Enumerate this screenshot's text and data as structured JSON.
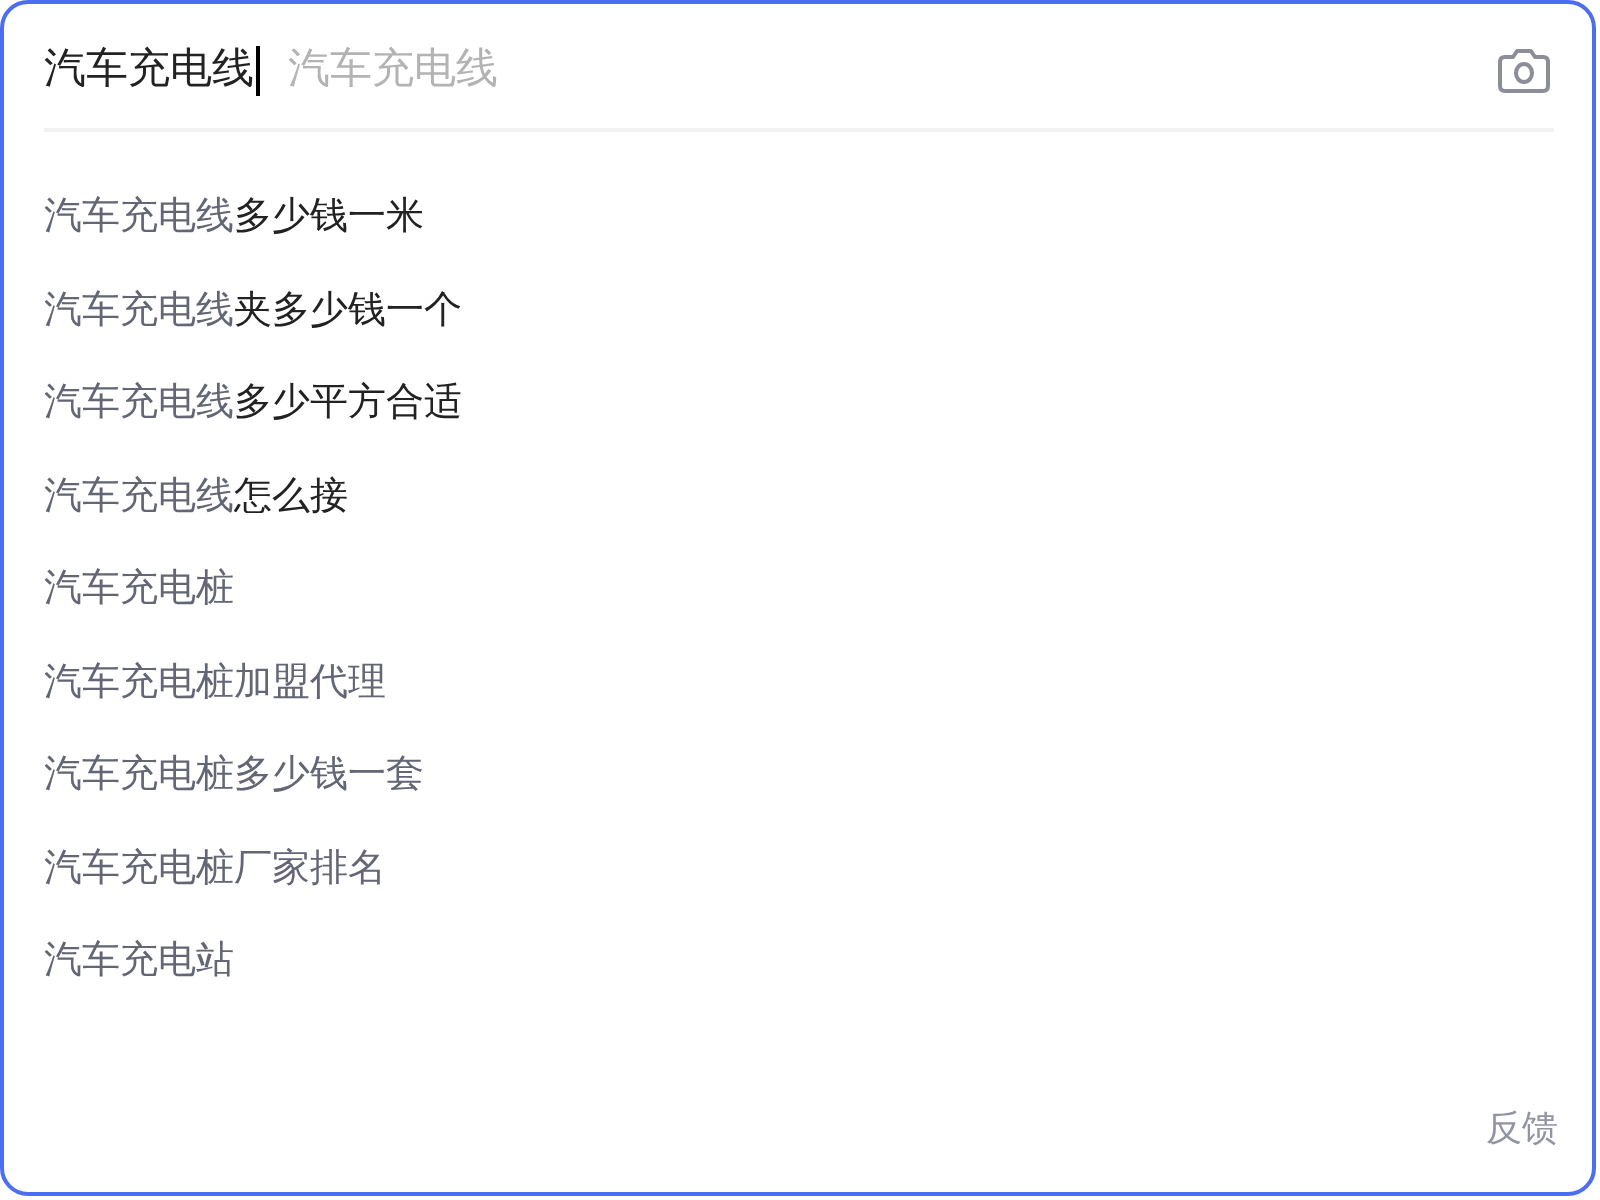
{
  "search": {
    "value": "汽车充电线",
    "focused": true,
    "completion": "汽车充电线"
  },
  "suggestions": [
    {
      "text": "汽车充电线**多少钱一米**"
    },
    {
      "text": "汽车充电线**夹多少钱一个**"
    },
    {
      "text": "汽车充电线**多少平方合适**"
    },
    {
      "text": "汽车充电线**怎么接**"
    },
    {
      "text": "汽车充电桩"
    },
    {
      "text": "汽车充电桩加盟代理"
    },
    {
      "text": "汽车充电桩多少钱一套"
    },
    {
      "text": "汽车充电桩厂家排名"
    },
    {
      "text": "汽车充电站"
    }
  ],
  "feedback_link": "反馈"
}
